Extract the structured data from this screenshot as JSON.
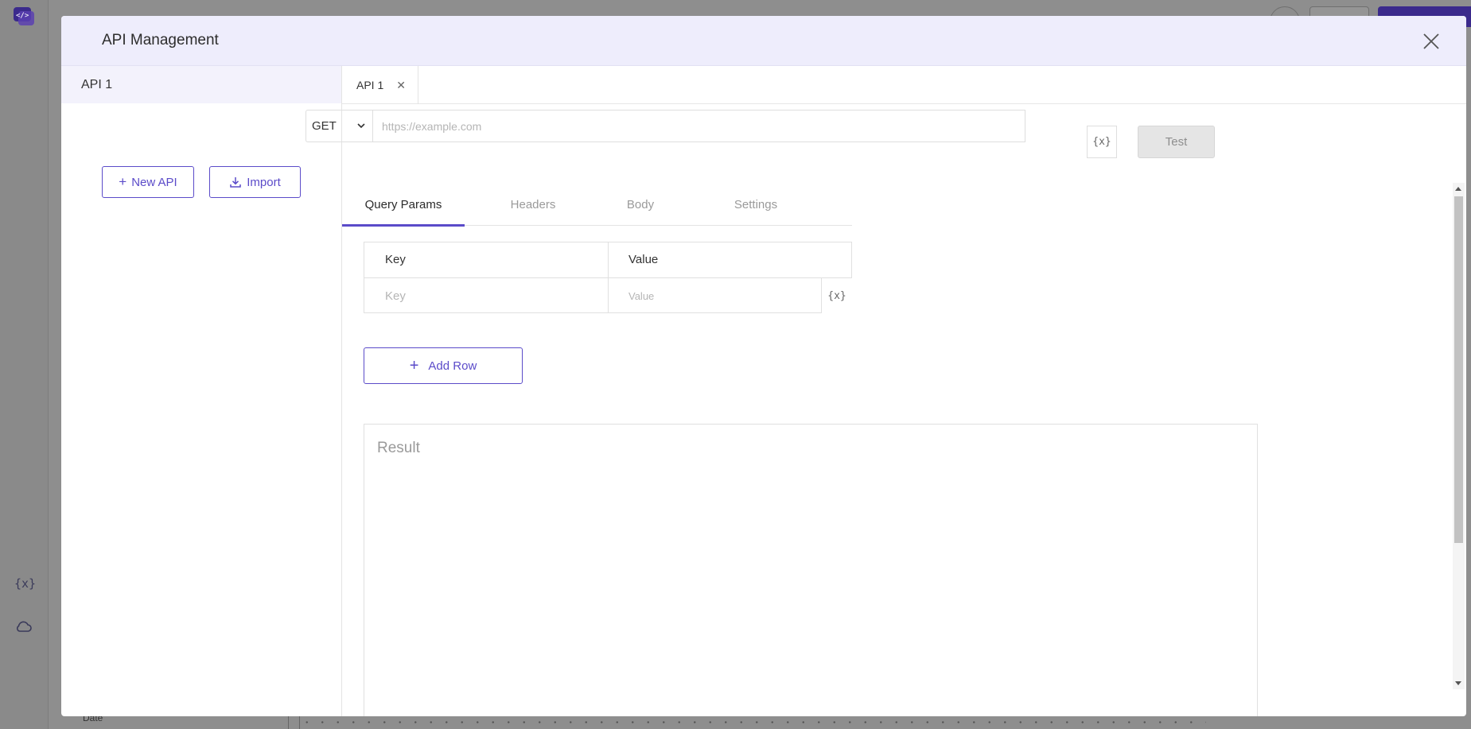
{
  "background": {
    "date_label": "Date"
  },
  "modal": {
    "title": "API Management"
  },
  "left_pane": {
    "items": [
      {
        "label": "API 1"
      }
    ],
    "new_api_label": "New API",
    "import_label": "Import"
  },
  "tabs": [
    {
      "label": "API 1"
    }
  ],
  "request": {
    "method": "GET",
    "url_value": "",
    "url_placeholder": "https://example.com",
    "variable_icon_text": "{x}",
    "test_label": "Test"
  },
  "request_tabs": [
    {
      "label": "Query Params",
      "active": true
    },
    {
      "label": "Headers",
      "active": false
    },
    {
      "label": "Body",
      "active": false
    },
    {
      "label": "Settings",
      "active": false
    }
  ],
  "params_table": {
    "headers": {
      "key": "Key",
      "value": "Value"
    },
    "rows": [
      {
        "key_value": "",
        "key_placeholder": "Key",
        "value_value": "",
        "value_placeholder": "Value"
      }
    ]
  },
  "add_row_label": "Add Row",
  "result": {
    "label": "Result"
  },
  "colors": {
    "accent": "#5b4bc9",
    "header_bg": "#eeedfc",
    "selected_item_bg": "#f3f2fc",
    "overlay": "#8e8e8e"
  }
}
